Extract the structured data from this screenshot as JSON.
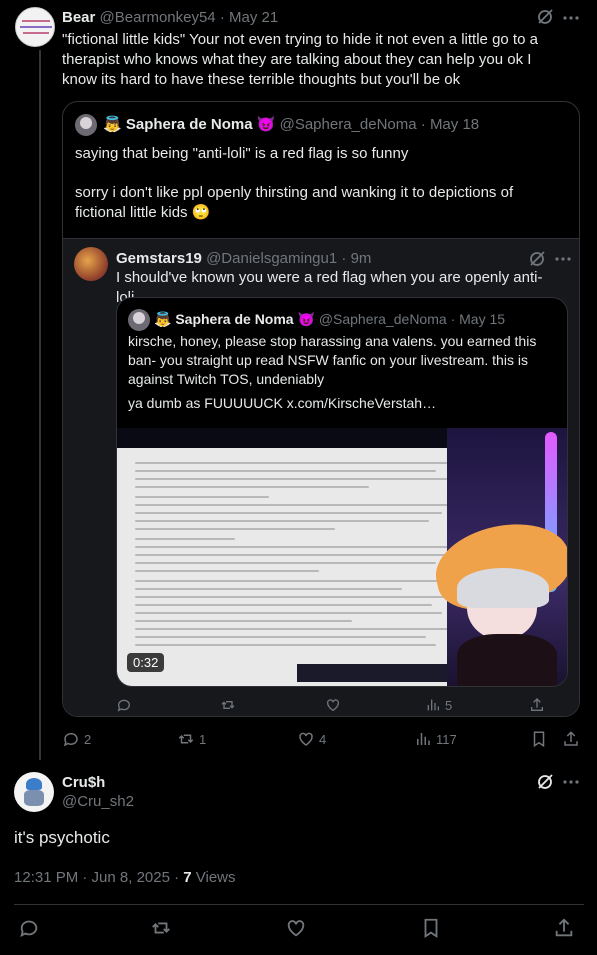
{
  "tweet1": {
    "name": "Bear",
    "handle": "@Bearmonkey54",
    "dot": "·",
    "date": "May 21",
    "text": "\"fictional little kids\" Your not even trying to hide it not even a little go to a therapist who knows what they are talking about they can help you ok I know its hard to have these terrible thoughts but you'll be ok",
    "stats": {
      "replies": "2",
      "retweets": "1",
      "likes": "4",
      "views": "117"
    }
  },
  "quote1": {
    "badge": "👼",
    "name": "Saphera de Noma",
    "emoji": "😈",
    "handle": "@Saphera_deNoma",
    "dot": "·",
    "date": "May 18",
    "line1": "saying that being \"anti-loli\" is a red flag is so funny",
    "line2": "sorry i don't like ppl openly thirsting and wanking it to depictions of fictional little kids",
    "line2_emoji": "🙄"
  },
  "quote2": {
    "name": "Gemstars19",
    "handle": "@Danielsgamingu1",
    "dot": "·",
    "date": "9m",
    "text": "I should've known you were a red flag when you are openly anti-loli",
    "stats": {
      "views": "5"
    }
  },
  "quote3": {
    "badge": "👼",
    "name": "Saphera de Noma",
    "emoji": "😈",
    "handle": "@Saphera_deNoma",
    "dot": "·",
    "date": "May 15",
    "text": "kirsche, honey, please stop harassing ana valens. you earned this ban- you straight up read NSFW fanfic on your livestream. this is against Twitch TOS, undeniably",
    "text2": "ya dumb as FUUUUUCK  x.com/KirscheVerstah…",
    "video_time": "0:32"
  },
  "main": {
    "name": "Cru$h",
    "handle": "@Cru_sh2",
    "text": "it's psychotic",
    "time": "12:31 PM · Jun 8, 2025 · ",
    "views_count": "7",
    "views_label": " Views"
  },
  "colors": {
    "bg": "#000000",
    "text": "#e7e9ea",
    "muted": "#71767b",
    "border": "#2f3336",
    "accent": "#1d9bf0"
  },
  "icons": [
    "grok-icon",
    "more-icon",
    "reply-icon",
    "retweet-icon",
    "like-icon",
    "views-icon",
    "bookmark-icon",
    "share-icon"
  ]
}
